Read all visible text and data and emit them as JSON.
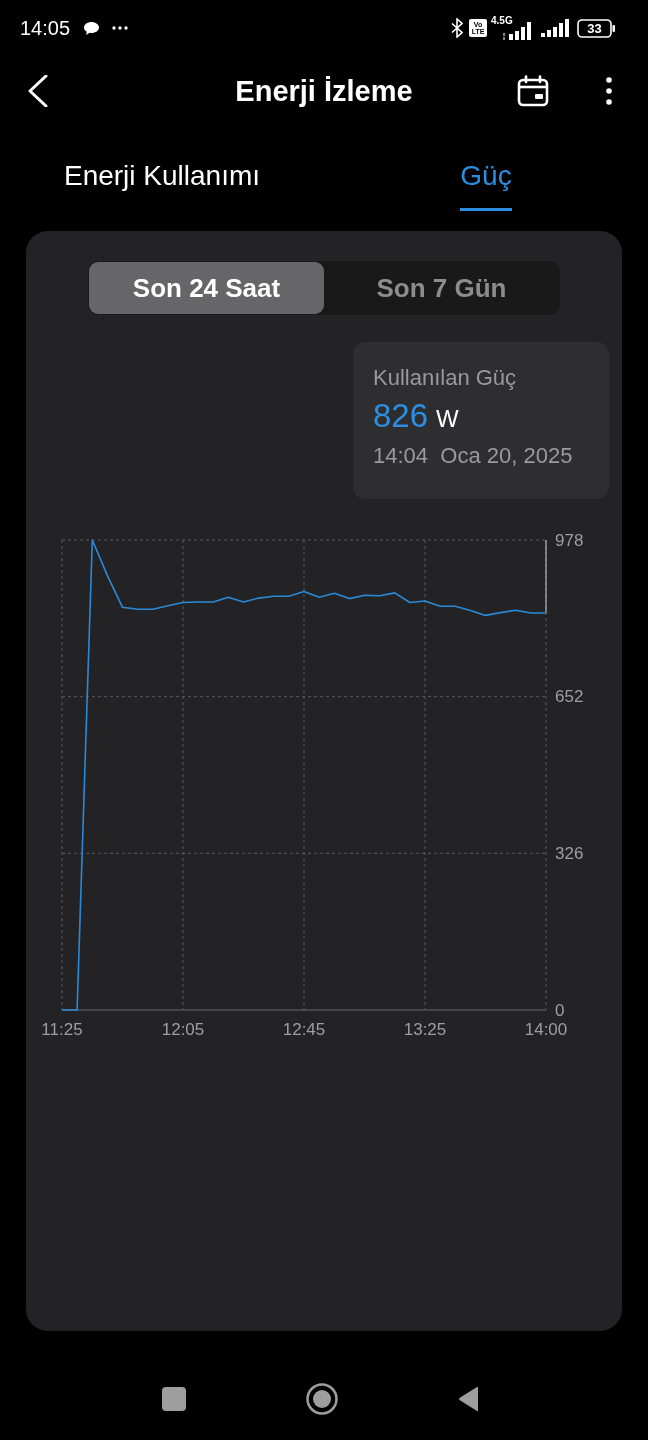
{
  "status_bar": {
    "time": "14:05",
    "volte": "Vo LTE",
    "network_type": "4.5G",
    "battery": "33"
  },
  "app_bar": {
    "title": "Enerji İzleme"
  },
  "tabs": [
    {
      "label": "Enerji Kullanımı",
      "selected": false
    },
    {
      "label": "Güç",
      "selected": true
    }
  ],
  "range_selector": [
    {
      "label": "Son 24 Saat",
      "selected": true
    },
    {
      "label": "Son 7 Gün",
      "selected": false
    }
  ],
  "tooltip": {
    "label": "Kullanılan Güç",
    "value": "826",
    "unit": "W",
    "timestamp": "14:04  Oca 20, 2025"
  },
  "chart_data": {
    "type": "line",
    "categories": [
      "11:25",
      null,
      null,
      null,
      null,
      null,
      null,
      null,
      "12:05",
      null,
      null,
      null,
      null,
      null,
      null,
      null,
      "12:45",
      null,
      null,
      null,
      null,
      null,
      null,
      null,
      "13:25",
      null,
      null,
      null,
      null,
      null,
      null,
      null,
      "14:00"
    ],
    "series": [
      {
        "color": "#2a8ad8",
        "values": [
          0,
          0,
          978,
          904,
          838,
          834,
          834,
          841,
          848,
          849,
          849,
          859,
          849,
          857,
          861,
          861,
          871,
          859,
          867,
          856,
          863,
          862,
          868,
          848,
          851,
          840,
          840,
          831,
          821,
          827,
          832,
          826,
          826
        ]
      }
    ],
    "ylim": [
      0,
      978
    ],
    "yticks": [
      0,
      326,
      652,
      978
    ],
    "grid": true
  }
}
